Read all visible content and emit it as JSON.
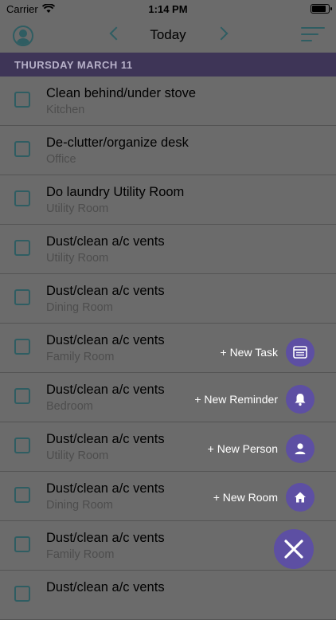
{
  "status": {
    "carrier": "Carrier",
    "time": "1:14 PM"
  },
  "nav": {
    "title": "Today"
  },
  "section": {
    "header": "THURSDAY MARCH 11"
  },
  "tasks": [
    {
      "title": "Clean behind/under stove",
      "room": "Kitchen"
    },
    {
      "title": "De-clutter/organize desk",
      "room": "Office"
    },
    {
      "title": "Do laundry Utility Room",
      "room": "Utility Room"
    },
    {
      "title": "Dust/clean a/c vents",
      "room": "Utility Room"
    },
    {
      "title": "Dust/clean a/c vents",
      "room": "Dining Room"
    },
    {
      "title": "Dust/clean a/c vents",
      "room": "Family Room"
    },
    {
      "title": "Dust/clean a/c vents",
      "room": "Bedroom"
    },
    {
      "title": "Dust/clean a/c vents",
      "room": "Utility Room"
    },
    {
      "title": "Dust/clean a/c vents",
      "room": "Dining Room"
    },
    {
      "title": "Dust/clean a/c vents",
      "room": "Family Room"
    },
    {
      "title": "Dust/clean a/c vents",
      "room": ""
    }
  ],
  "fab": {
    "new_task": "+ New Task",
    "new_reminder": "+ New Reminder",
    "new_person": "+ New Person",
    "new_room": "+ New Room"
  },
  "colors": {
    "accent": "#5d4fa3",
    "teal": "#2f5d62",
    "header": "#3e3557"
  }
}
